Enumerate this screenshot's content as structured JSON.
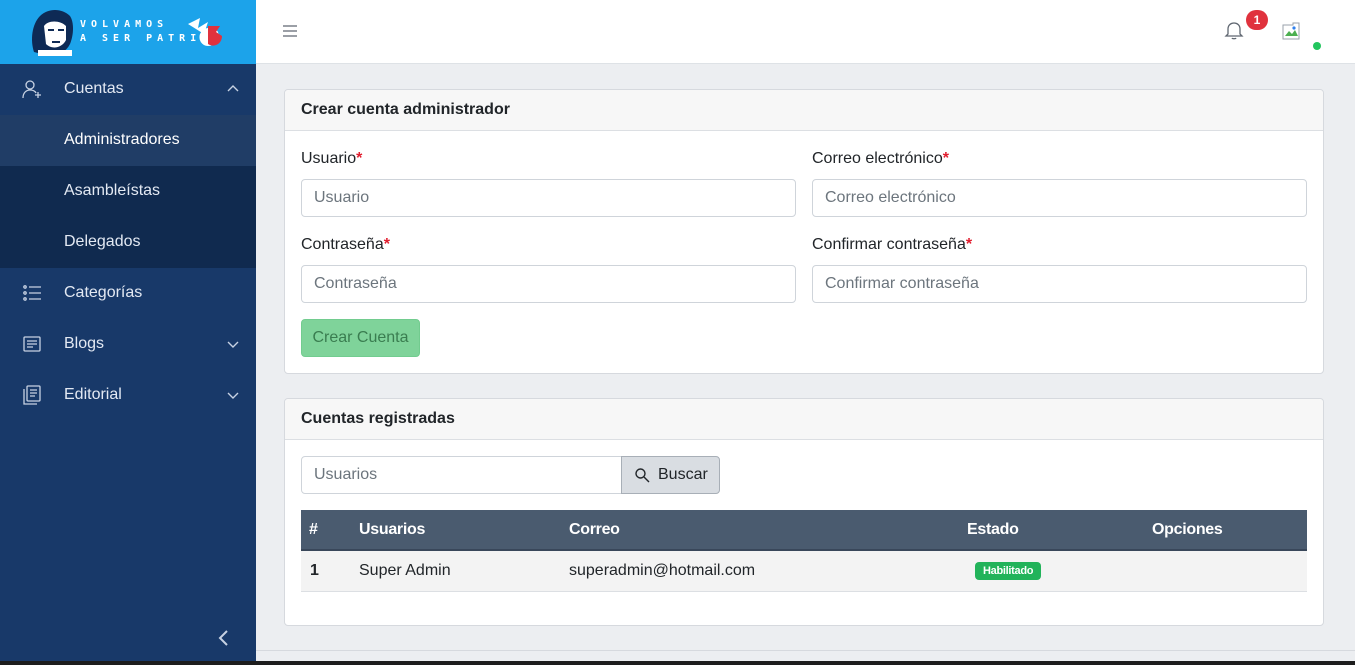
{
  "brand": {
    "line1": "VOLVAMOS",
    "line2": "A SER PATRIA"
  },
  "sidebar": {
    "items": [
      {
        "label": "Cuentas",
        "icon": "user-plus-icon"
      },
      {
        "label": "Administradores"
      },
      {
        "label": "Asambleístas"
      },
      {
        "label": "Delegados"
      },
      {
        "label": "Categorías",
        "icon": "list-icon"
      },
      {
        "label": "Blogs",
        "icon": "document-icon"
      },
      {
        "label": "Editorial",
        "icon": "copy-icon"
      }
    ]
  },
  "topbar": {
    "notifications_count": "1"
  },
  "create_card": {
    "title": "Crear cuenta administrador",
    "username_label": "Usuario",
    "username_placeholder": "Usuario",
    "email_label": "Correo electrónico",
    "email_placeholder": "Correo electrónico",
    "password_label": "Contraseña",
    "password_placeholder": "Contraseña",
    "confirm_label": "Confirmar contraseña",
    "confirm_placeholder": "Confirmar contraseña",
    "required_mark": "*",
    "submit_label": "Crear Cuenta"
  },
  "accounts_card": {
    "title": "Cuentas registradas",
    "search_placeholder": "Usuarios",
    "search_button": "Buscar",
    "columns": [
      "#",
      "Usuarios",
      "Correo",
      "Estado",
      "Opciones"
    ],
    "rows": [
      {
        "index": "1",
        "user": "Super Admin",
        "email": "superadmin@hotmail.com",
        "status": "Habilitado"
      }
    ]
  },
  "colors": {
    "sidebar_bg": "#183969",
    "brand_bg": "#1ca3ea",
    "table_header_bg": "#4a5b6f",
    "success": "#22b35a",
    "create_button": "#7fd39a",
    "badge_red": "#e0323d"
  }
}
